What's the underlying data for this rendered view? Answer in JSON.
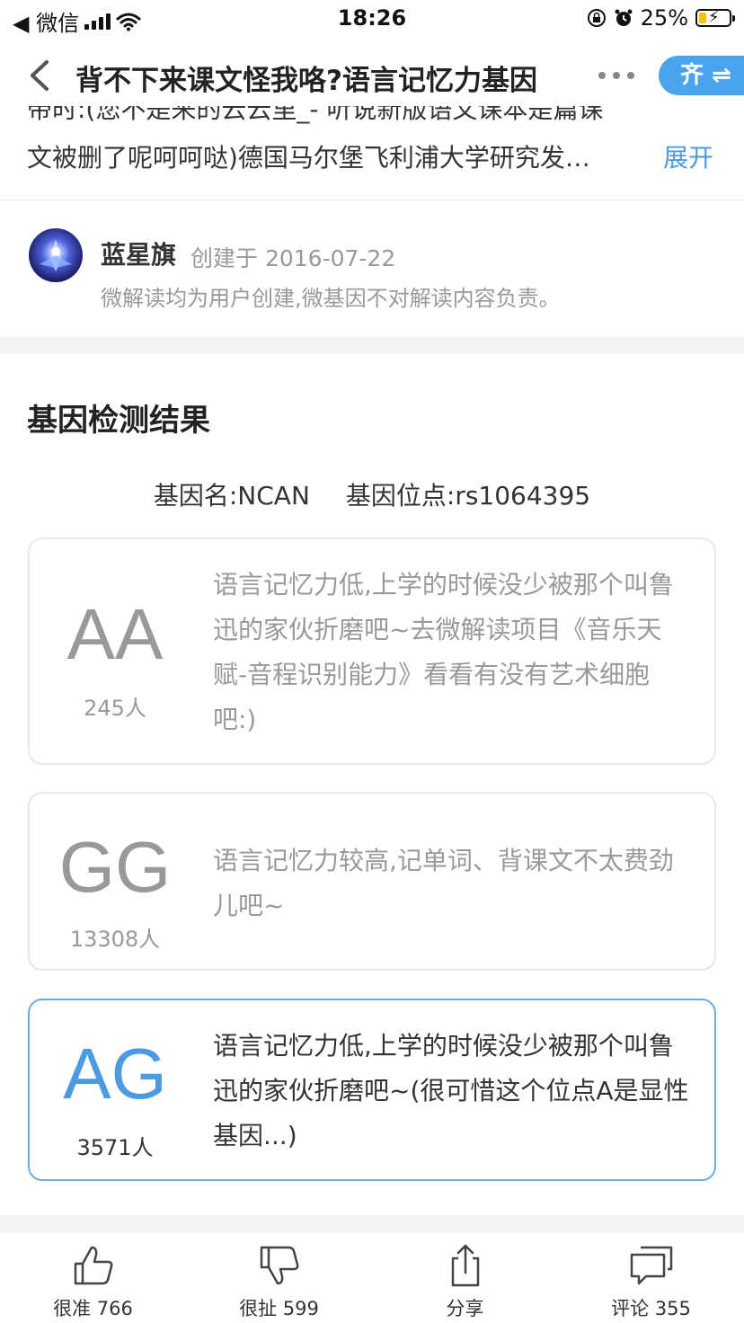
{
  "status_bar": {
    "carrier": "◀ 微信",
    "time": "18:26",
    "battery_percent": "25%",
    "battery_level": 0.25
  },
  "nav": {
    "title": "背不下来课文怪我咯?语言记忆力基因",
    "qi_label": "齐 ⇌"
  },
  "summary": {
    "cut_line": "带时:(您不是来的云云里_- 听说新版语文课本是篇课",
    "line": "文被删了呢呵呵哒)德国马尔堡飞利浦大学研究发…",
    "expand_label": "展开"
  },
  "author": {
    "name": "蓝星旗",
    "created": "创建于 2016-07-22",
    "disclaimer": "微解读均为用户创建,微基因不对解读内容负责。"
  },
  "results": {
    "section_title": "基因检测结果",
    "gene_name": "基因名:NCAN",
    "gene_locus": "基因位点:rs1064395",
    "cards": [
      {
        "genotype": "AA",
        "count": "245人",
        "description": "语言记忆力低,上学的时候没少被那个叫鲁迅的家伙折磨吧~去微解读项目《音乐天赋-音程识别能力》看看有没有艺术细胞吧:)"
      },
      {
        "genotype": "GG",
        "count": "13308人",
        "description": "语言记忆力较高,记单词、背课文不太费劲儿吧~"
      },
      {
        "genotype": "AG",
        "count": "3571人",
        "description": "语言记忆力低,上学的时候没少被那个叫鲁迅的家伙折磨吧~(很可惜这个位点A是显性基因...)",
        "selected": true
      }
    ]
  },
  "bottom_bar": {
    "items": [
      {
        "label": "很准 766",
        "icon": "thumbs-up-icon"
      },
      {
        "label": "很扯 599",
        "icon": "thumbs-down-icon"
      },
      {
        "label": "分享",
        "icon": "share-icon"
      },
      {
        "label": "评论 355",
        "icon": "comment-icon"
      }
    ]
  },
  "colors": {
    "accent": "#4a9be3",
    "selected_border": "#6aaee8",
    "muted_text": "#999999"
  }
}
